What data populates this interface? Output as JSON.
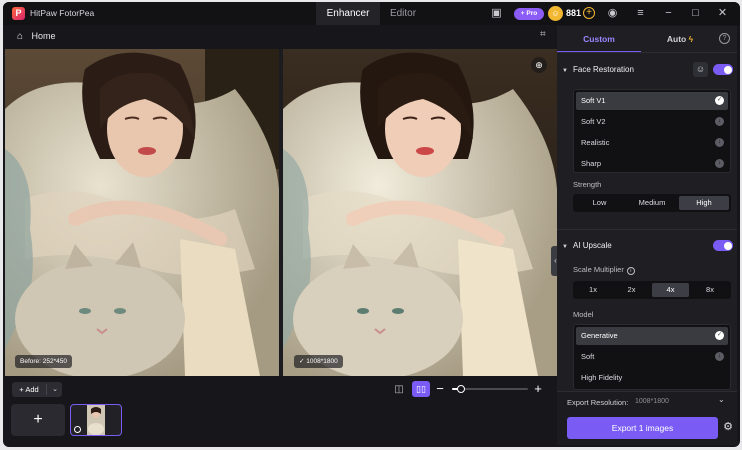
{
  "app": {
    "title": "HitPaw FotorPea",
    "logo_letter": "P",
    "tabs": [
      {
        "label": "Enhancer",
        "active": true
      },
      {
        "label": "Editor",
        "active": false
      }
    ],
    "pro_label": "+ Pro",
    "credits": "881"
  },
  "toolbar": {
    "home_label": "Home"
  },
  "preview": {
    "before_label": "Before: 252*450",
    "after_label": "1008*1800"
  },
  "bottom": {
    "add_label": "+ Add",
    "zoom_level": 0.12
  },
  "panel": {
    "tabs": [
      {
        "label": "Custom",
        "active": true
      },
      {
        "label": "Auto",
        "active": false
      }
    ],
    "face_restoration": {
      "title": "Face Restoration",
      "enabled": true,
      "models": [
        "Soft V1",
        "Soft V2",
        "Realistic",
        "Sharp"
      ],
      "selected_model": "Soft V1",
      "strength_label": "Strength",
      "strength_options": [
        "Low",
        "Medium",
        "High"
      ],
      "selected_strength": "High"
    },
    "ai_upscale": {
      "title": "AI Upscale",
      "enabled": true,
      "scale_label": "Scale Multiplier",
      "scale_options": [
        "1x",
        "2x",
        "4x",
        "8x"
      ],
      "selected_scale": "4x",
      "model_label": "Model",
      "models": [
        "Generative",
        "Soft",
        "High Fidelity"
      ],
      "selected_model": "Generative"
    },
    "export": {
      "resolution_label": "Export Resolution:",
      "resolution_value": "1008*1800",
      "button_label": "Export 1 images"
    }
  },
  "colors": {
    "accent": "#7a5cf5",
    "background": "#17171b",
    "panel": "#1e1e23",
    "coin": "#f3b832"
  }
}
